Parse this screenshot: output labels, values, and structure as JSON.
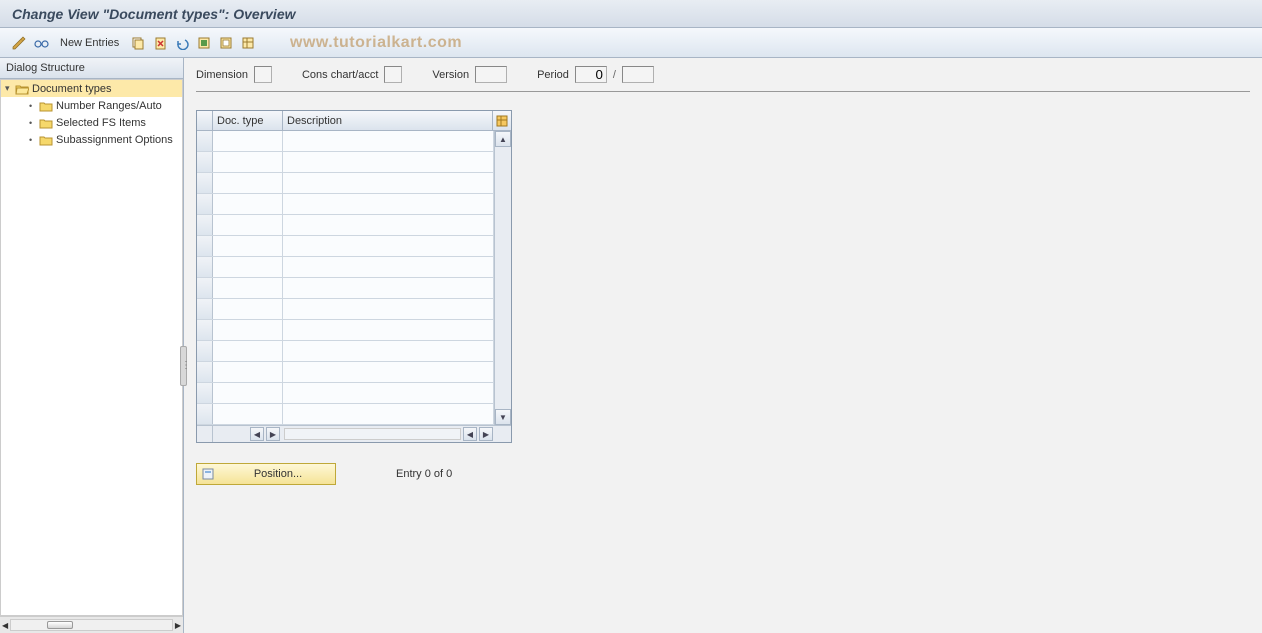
{
  "title": "Change View \"Document types\": Overview",
  "toolbar": {
    "new_entries_label": "New Entries"
  },
  "watermark": "www.tutorialkart.com",
  "tree": {
    "header": "Dialog Structure",
    "root": "Document types",
    "children": [
      "Number Ranges/Auto",
      "Selected FS Items",
      "Subassignment Options"
    ]
  },
  "header_fields": {
    "dimension_label": "Dimension",
    "dimension_value": "",
    "cons_label": "Cons chart/acct",
    "cons_value": "",
    "version_label": "Version",
    "version_value": "",
    "period_label": "Period",
    "period_value1": "0",
    "period_value2": ""
  },
  "table": {
    "col_doc": "Doc. type",
    "col_desc": "Description"
  },
  "footer": {
    "position_label": "Position...",
    "entry_text": "Entry 0 of 0"
  }
}
